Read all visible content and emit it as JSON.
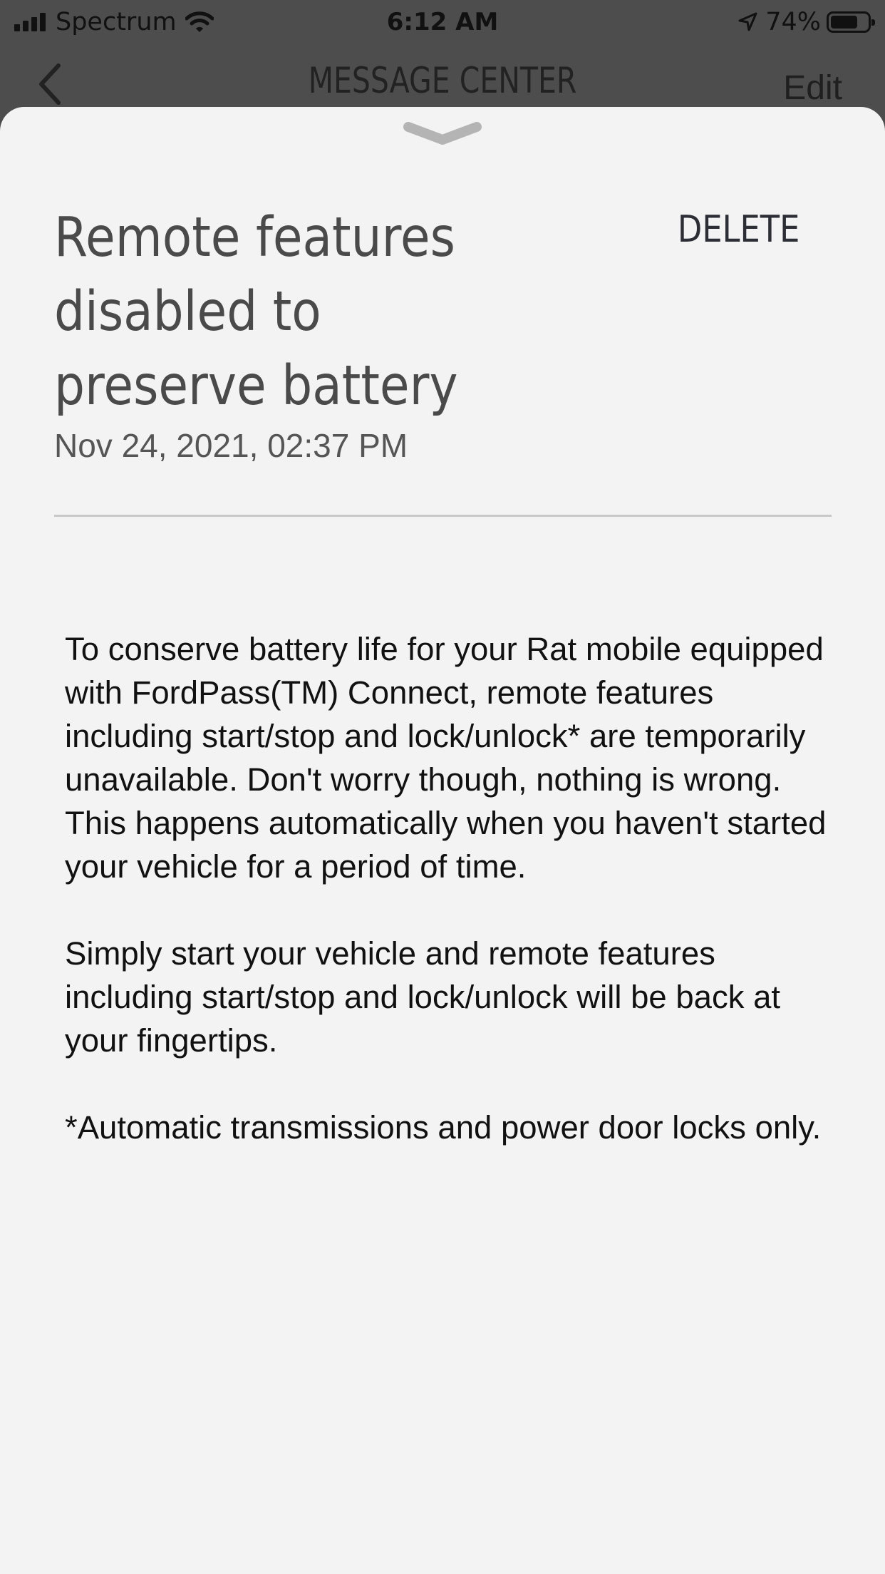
{
  "status_bar": {
    "carrier": "Spectrum",
    "time": "6:12 AM",
    "battery_percent": "74%",
    "battery_level": 0.74
  },
  "nav": {
    "back_icon": "chevron-left-icon",
    "title": "MESSAGE CENTER",
    "edit_label": "Edit"
  },
  "sheet": {
    "grabber_icon": "chevron-down-icon"
  },
  "message": {
    "title": "Remote features disabled to preserve battery",
    "delete_label": "DELETE",
    "date": "Nov 24, 2021, 02:37 PM",
    "paragraphs": [
      "To conserve battery life for your Rat mobile equipped with FordPass(TM) Connect, remote features including start/stop and lock/unlock* are temporarily unavailable. Don't worry though, nothing is wrong. This happens automatically when you haven't started your vehicle for a period of time.",
      "Simply start your vehicle and remote features including start/stop and lock/unlock will be back at your fingertips.",
      "*Automatic transmissions and power door locks only."
    ]
  }
}
